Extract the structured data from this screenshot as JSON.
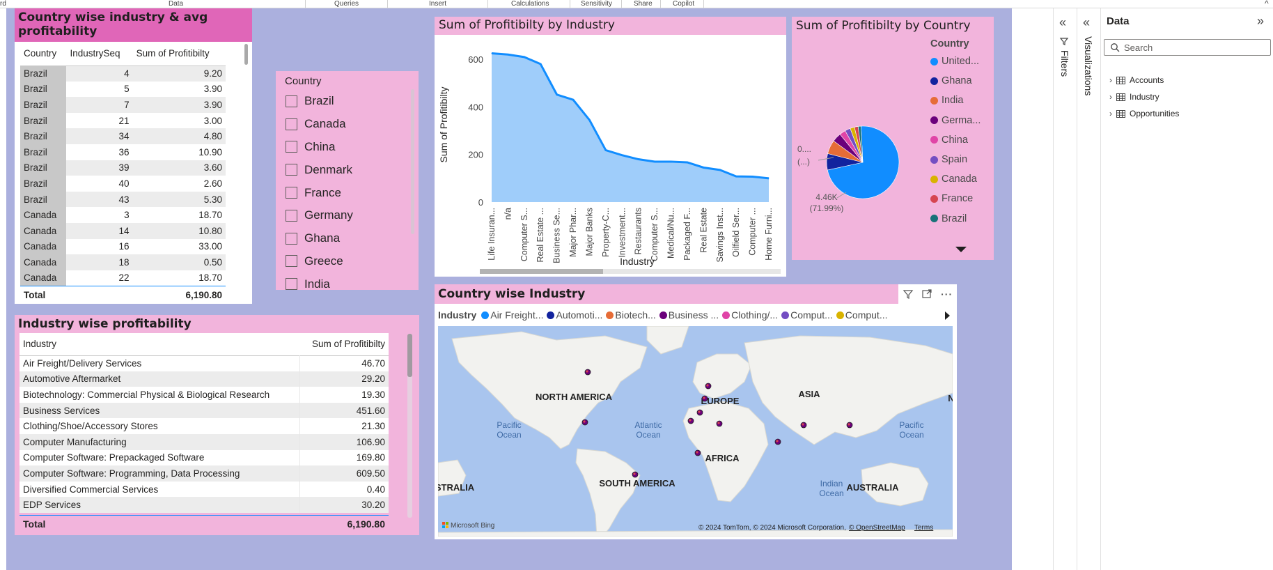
{
  "ribbon": {
    "labels": [
      "rd",
      "Data",
      "Queries",
      "Insert",
      "Calculations",
      "Sensitivity",
      "Share",
      "Copilot"
    ]
  },
  "table1": {
    "title": "Country wise industry & avg profitability",
    "headers": [
      "Country",
      "IndustrySeq",
      "Sum of Profitibilty"
    ],
    "rows": [
      [
        "Brazil",
        "4",
        "9.20"
      ],
      [
        "Brazil",
        "5",
        "3.90"
      ],
      [
        "Brazil",
        "7",
        "3.90"
      ],
      [
        "Brazil",
        "21",
        "3.00"
      ],
      [
        "Brazil",
        "34",
        "4.80"
      ],
      [
        "Brazil",
        "36",
        "10.90"
      ],
      [
        "Brazil",
        "39",
        "3.60"
      ],
      [
        "Brazil",
        "40",
        "2.60"
      ],
      [
        "Brazil",
        "43",
        "5.30"
      ],
      [
        "Canada",
        "3",
        "18.70"
      ],
      [
        "Canada",
        "14",
        "10.80"
      ],
      [
        "Canada",
        "16",
        "33.00"
      ],
      [
        "Canada",
        "18",
        "0.50"
      ],
      [
        "Canada",
        "22",
        "18.70"
      ]
    ],
    "total_label": "Total",
    "total_value": "6,190.80"
  },
  "slicer": {
    "title": "Country",
    "items": [
      "Brazil",
      "Canada",
      "China",
      "Denmark",
      "France",
      "Germany",
      "Ghana",
      "Greece",
      "India"
    ]
  },
  "table2": {
    "title": "Industry wise profitability",
    "headers": [
      "Industry",
      "Sum of Profitibilty"
    ],
    "rows": [
      [
        "Air Freight/Delivery Services",
        "46.70"
      ],
      [
        "Automotive Aftermarket",
        "29.20"
      ],
      [
        "Biotechnology: Commercial Physical & Biological Research",
        "19.30"
      ],
      [
        "Business Services",
        "451.60"
      ],
      [
        "Clothing/Shoe/Accessory Stores",
        "21.30"
      ],
      [
        "Computer Manufacturing",
        "106.90"
      ],
      [
        "Computer Software: Prepackaged Software",
        "169.80"
      ],
      [
        "Computer Software: Programming, Data Processing",
        "609.50"
      ],
      [
        "Diversified Commercial Services",
        "0.40"
      ],
      [
        "EDP Services",
        "30.20"
      ]
    ],
    "total_label": "Total",
    "total_value": "6,190.80"
  },
  "chart_data": [
    {
      "type": "area",
      "title": "Sum of Profitibilty by Industry",
      "xlabel": "Industry",
      "ylabel": "Sum of Profitibilty",
      "ylim": [
        0,
        650
      ],
      "yticks": [
        0,
        200,
        400,
        600
      ],
      "categories": [
        "Life Insuran...",
        "n/a",
        "Computer S...",
        "Real Estate ...",
        "Business Se...",
        "Major Phar...",
        "Major Banks",
        "Property-C...",
        "Investment...",
        "Restaurants",
        "Computer S...",
        "Medical/Nu...",
        "Packaged F...",
        "Real Estate",
        "Savings Inst...",
        "Oilfield Ser...",
        "Computer ...",
        "Home Furni..."
      ],
      "values": [
        625,
        620,
        609.5,
        580,
        451.6,
        430,
        345,
        218,
        197,
        180,
        169.8,
        170,
        167,
        145,
        135,
        108,
        106.9,
        100
      ],
      "color": "#118dff"
    },
    {
      "type": "pie",
      "title": "Sum of Profitibilty by Country",
      "legend_title": "Country",
      "legend": [
        "United...",
        "Ghana",
        "India",
        "Germa...",
        "China",
        "Spain",
        "Canada",
        "France",
        "Brazil"
      ],
      "values": [
        4456,
        450,
        380,
        250,
        170,
        150,
        120,
        100,
        80
      ],
      "colors": [
        "#118dff",
        "#12239e",
        "#e66c37",
        "#6b007b",
        "#e044a7",
        "#744ec2",
        "#d9b300",
        "#d64550",
        "#197278"
      ],
      "data_labels": [
        {
          "value": "4.46K",
          "percent": "(71.99%)"
        },
        {
          "value": "0....",
          "percent": "(...)"
        }
      ]
    }
  ],
  "map": {
    "title": "Country wise Industry",
    "legend_title": "Industry",
    "legend": [
      {
        "label": "Air Freight...",
        "color": "#118dff"
      },
      {
        "label": "Automoti...",
        "color": "#12239e"
      },
      {
        "label": "Biotech...",
        "color": "#e66c37"
      },
      {
        "label": "Business ...",
        "color": "#6b007b"
      },
      {
        "label": "Clothing/...",
        "color": "#e044a7"
      },
      {
        "label": "Comput...",
        "color": "#744ec2"
      },
      {
        "label": "Comput...",
        "color": "#d9b300"
      }
    ],
    "labels": {
      "north_america": "NORTH AMERICA",
      "europe": "EUROPE",
      "asia": "ASIA",
      "africa": "AFRICA",
      "south_america": "SOUTH AMERICA",
      "australia": "AUSTRALIA",
      "stralia": "STRALIA",
      "n": "N",
      "pacific1": "Pacific Ocean",
      "pacific2": "Pacific Ocean",
      "atlantic": "Atlantic Ocean",
      "indian": "Indian Ocean"
    },
    "bing": "Microsoft Bing",
    "copyright": "© 2024 TomTom, © 2024 Microsoft Corporation,",
    "osm": "© OpenStreetMap",
    "terms": "Terms"
  },
  "panes": {
    "filters": "Filters",
    "visualizations": "Visualizations",
    "data_title": "Data",
    "search_placeholder": "Search",
    "fields": [
      "Accounts",
      "Industry",
      "Opportunities"
    ]
  }
}
